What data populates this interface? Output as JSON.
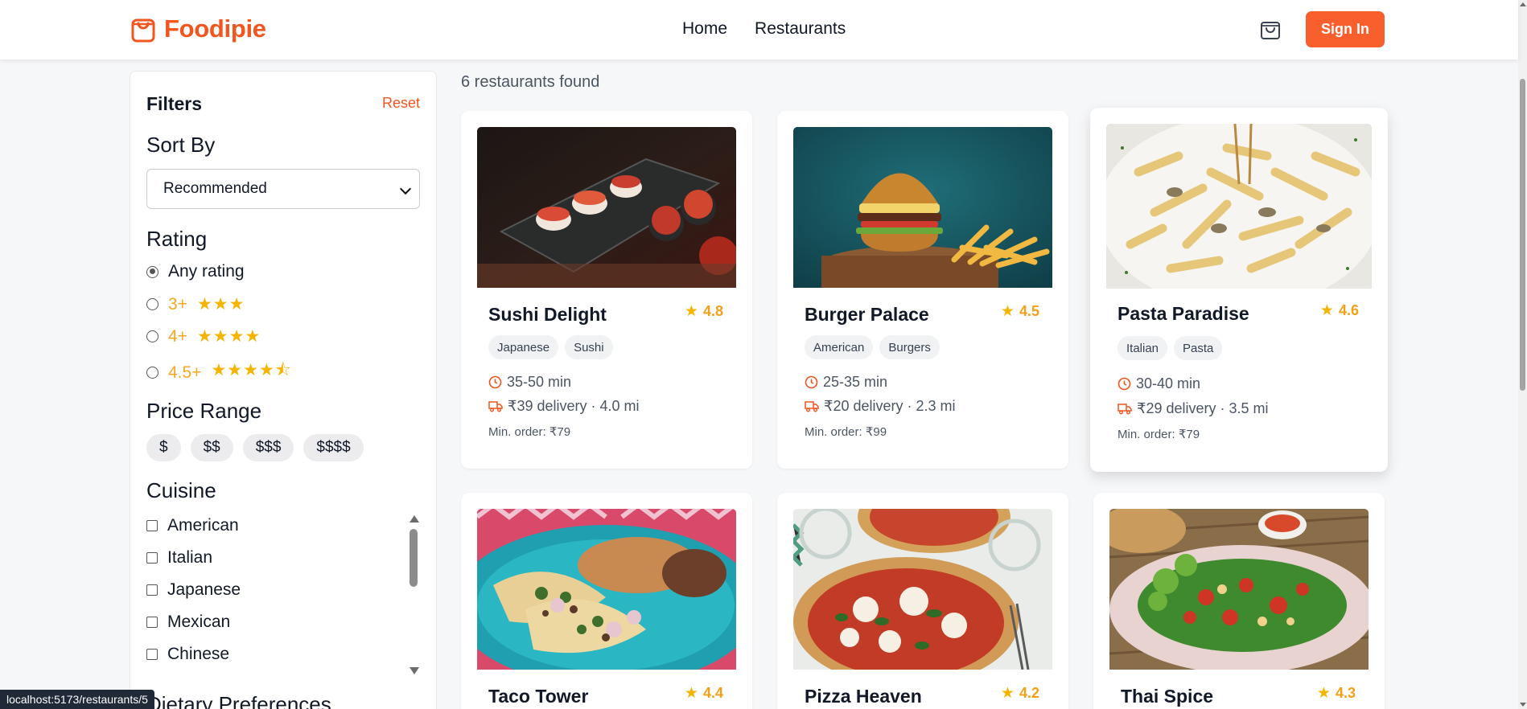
{
  "brand": {
    "name": "Foodipie",
    "accent": "#f2551d"
  },
  "nav": {
    "items": [
      "Home",
      "Restaurants"
    ]
  },
  "header": {
    "cart_icon": "shopping-bag-icon",
    "signin_label": "Sign In"
  },
  "filters": {
    "title": "Filters",
    "reset_label": "Reset",
    "sort": {
      "title": "Sort By",
      "selected": "Recommended"
    },
    "rating": {
      "title": "Rating",
      "options": [
        {
          "label": "Any rating",
          "stars": "",
          "checked": true
        },
        {
          "label": "3+",
          "stars": "★★★",
          "checked": false
        },
        {
          "label": "4+",
          "stars": "★★★★",
          "checked": false
        },
        {
          "label": "4.5+",
          "stars": "★★★★⯪",
          "checked": false
        }
      ]
    },
    "price": {
      "title": "Price Range",
      "options": [
        "$",
        "$$",
        "$$$",
        "$$$$"
      ]
    },
    "cuisine": {
      "title": "Cuisine",
      "options": [
        "American",
        "Italian",
        "Japanese",
        "Mexican",
        "Chinese"
      ]
    },
    "dietary": {
      "title": "Dietary Preferences"
    }
  },
  "results": {
    "count_text": "6 restaurants found"
  },
  "restaurants": [
    {
      "name": "Sushi Delight",
      "rating": "4.8",
      "tags": [
        "Japanese",
        "Sushi"
      ],
      "time": "35-50 min",
      "delivery": "₹39 delivery · 4.0 mi",
      "min_order": "Min. order: ₹79"
    },
    {
      "name": "Burger Palace",
      "rating": "4.5",
      "tags": [
        "American",
        "Burgers"
      ],
      "time": "25-35 min",
      "delivery": "₹20 delivery · 2.3 mi",
      "min_order": "Min. order: ₹99"
    },
    {
      "name": "Pasta Paradise",
      "rating": "4.6",
      "tags": [
        "Italian",
        "Pasta"
      ],
      "time": "30-40 min",
      "delivery": "₹29 delivery · 3.5 mi",
      "min_order": "Min. order: ₹79"
    },
    {
      "name": "Taco Tower",
      "rating": "4.4"
    },
    {
      "name": "Pizza Heaven",
      "rating": "4.2"
    },
    {
      "name": "Thai Spice",
      "rating": "4.3"
    }
  ],
  "status_bar": {
    "url": "localhost:5173/restaurants/5"
  }
}
